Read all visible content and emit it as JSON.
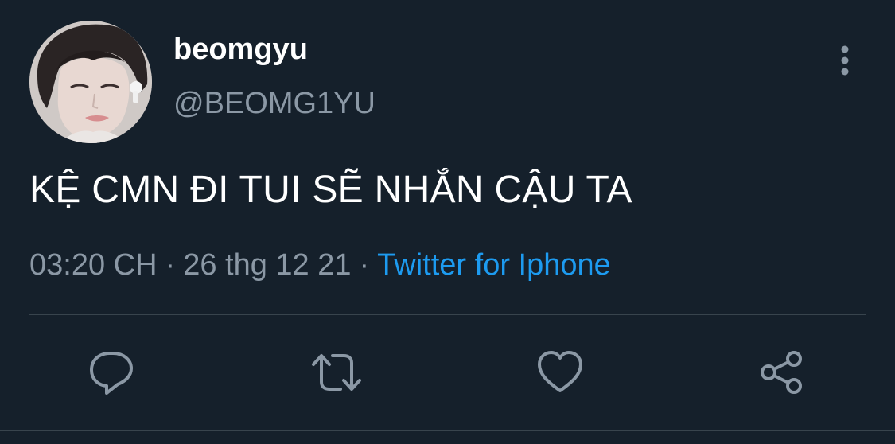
{
  "tweet": {
    "display_name": "beomgyu",
    "handle": "@BEOMG1YU",
    "text": "KỆ CMN ĐI TUI SẼ NHẮN CẬU TA",
    "time": "03:20 CH",
    "separator": "·",
    "date": "26 thg 12 21",
    "source": "Twitter for Iphone"
  },
  "icons": {
    "more": "more-vertical-icon",
    "reply": "reply-icon",
    "retweet": "retweet-icon",
    "like": "heart-icon",
    "share": "share-icon"
  },
  "colors": {
    "background": "#15202b",
    "primary_text": "#ffffff",
    "secondary_text": "#8b98a5",
    "link": "#1d9bf0",
    "divider": "#38444d"
  }
}
